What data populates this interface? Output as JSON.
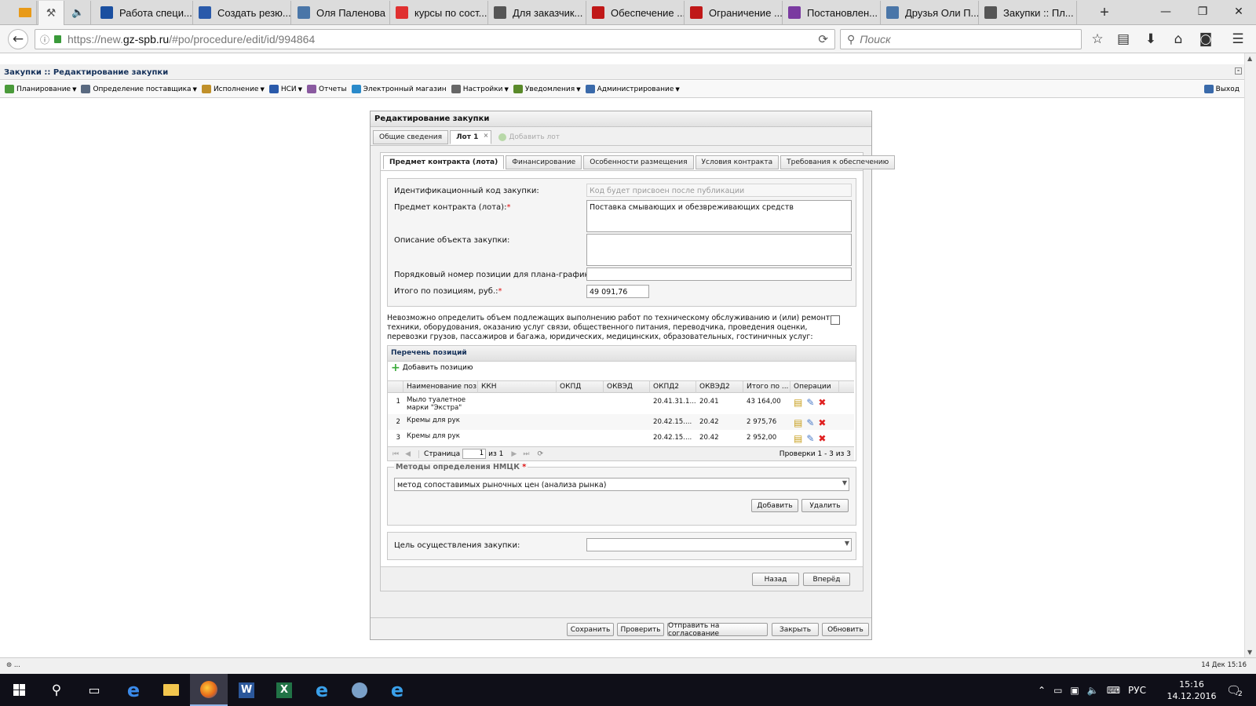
{
  "browser": {
    "tabs": [
      {
        "label": "Работа специ...",
        "icon": "hammer-icon",
        "color": "#1a4fa0"
      },
      {
        "label": "Создать резю...",
        "icon": "superjob-icon",
        "color": "#2a5aaa"
      },
      {
        "label": "Оля Паленова",
        "icon": "vk-icon",
        "color": "#4a76a8"
      },
      {
        "label": "курсы по сост...",
        "icon": "yandex-icon",
        "color": "#e03030"
      },
      {
        "label": "Для заказчик...",
        "icon": "hammer-icon",
        "color": "#555555"
      },
      {
        "label": "Обеспечение ...",
        "icon": "coat-of-arms-icon",
        "color": "#c01818"
      },
      {
        "label": "Ограничение ...",
        "icon": "coat-of-arms-icon",
        "color": "#c01818"
      },
      {
        "label": "Постановлен...",
        "icon": "flag-icon",
        "color": "#7a3aa0"
      },
      {
        "label": "Друзья Оли П...",
        "icon": "vk-icon",
        "color": "#4a76a8"
      },
      {
        "label": "Закупки :: Пл...",
        "icon": "hammer-icon",
        "color": "#555555"
      }
    ],
    "url_prefix": "https://new.",
    "url_host": "gz-spb.ru",
    "url_rest": "/#po/procedure/edit/id/994864",
    "search_placeholder": "Поиск"
  },
  "app": {
    "title": "Закупки :: Редактирование закупки",
    "menu": [
      {
        "label": "Планирование",
        "dropdown": true,
        "color": "#4a9a3a"
      },
      {
        "label": "Определение поставщика",
        "dropdown": true,
        "color": "#5a6a80"
      },
      {
        "label": "Исполнение",
        "dropdown": true,
        "color": "#c0902a"
      },
      {
        "label": "НСИ",
        "dropdown": true,
        "color": "#2a5aaa"
      },
      {
        "label": "Отчеты",
        "dropdown": false,
        "color": "#8a5aa0"
      },
      {
        "label": "Электронный магазин",
        "dropdown": false,
        "color": "#2a8aca"
      },
      {
        "label": "Настройки",
        "dropdown": true,
        "color": "#666666"
      },
      {
        "label": "Уведомления",
        "dropdown": true,
        "color": "#5a8a2a"
      },
      {
        "label": "Администрирование",
        "dropdown": true,
        "color": "#3a6aaa"
      }
    ],
    "logout": "Выход"
  },
  "panel": {
    "title": "Редактирование закупки",
    "top_tabs": [
      "Общие сведения",
      "Лот 1",
      "Добавить лот"
    ],
    "sub_tabs": [
      "Предмет контракта (лота)",
      "Финансирование",
      "Особенности размещения",
      "Условия контракта",
      "Требования к обеспечению"
    ],
    "fields": {
      "id_code_label": "Идентификационный код закупки:",
      "id_code_placeholder": "Код будет присвоен после публикации",
      "subject_label": "Предмет контракта (лота):",
      "subject_value": "Поставка смывающих и обезвреживающих средств",
      "description_label": "Описание объекта закупки:",
      "description_value": "",
      "position_label": "Порядковый номер позиции для плана-графика:",
      "position_value": "",
      "total_label": "Итого по позициям, руб.:",
      "total_value": "49 091,76"
    },
    "notice": "Невозможно определить объем подлежащих выполнению работ по техническому обслуживанию и (или) ремонту техники, оборудования, оказанию услуг связи, общественного питания, переводчика, проведения оценки, перевозки грузов, пассажиров и багажа, юридических, медицинских, образовательных, гостиничных услуг:",
    "notice_checked": false,
    "grid": {
      "title": "Перечень позиций",
      "add_label": "Добавить позицию",
      "columns": [
        "Наименование поз...",
        "ККН",
        "ОКПД",
        "ОКВЭД",
        "ОКПД2",
        "ОКВЭД2",
        "Итого по ...",
        "Операции"
      ],
      "rows": [
        {
          "n": "1",
          "name1": "Мыло туалетное",
          "name2": "марки \"Экстра\"",
          "okpd2": "20.41.31.1...",
          "okved2": "20.41",
          "total": "43 164,00"
        },
        {
          "n": "2",
          "name1": "Кремы для рук",
          "name2": "",
          "okpd2": "20.42.15....",
          "okved2": "20.42",
          "total": "2 975,76"
        },
        {
          "n": "3",
          "name1": "Кремы для рук",
          "name2": "",
          "okpd2": "20.42.15....",
          "okved2": "20.42",
          "total": "2 952,00"
        }
      ],
      "pager": {
        "page_label": "Страница",
        "page_value": "1",
        "of_label": "из 1",
        "summary": "Проверки 1 - 3 из 3"
      }
    },
    "methods": {
      "label": "Методы определения НМЦК",
      "value": "метод сопоставимых рыночных цен (анализа рынка)",
      "add": "Добавить",
      "remove": "Удалить"
    },
    "purpose_label": "Цель осуществления закупки:",
    "purpose_value": "",
    "nav": {
      "back": "Назад",
      "forward": "Вперёд"
    },
    "footer_buttons": [
      "Сохранить",
      "Проверить",
      "Отправить на согласование",
      "Закрыть",
      "Обновить"
    ]
  },
  "status": {
    "left": "...",
    "right": "14 Дек 15:16"
  },
  "taskbar": {
    "lang": "РУС",
    "time": "15:16",
    "date": "14.12.2016",
    "notif_count": "2"
  }
}
